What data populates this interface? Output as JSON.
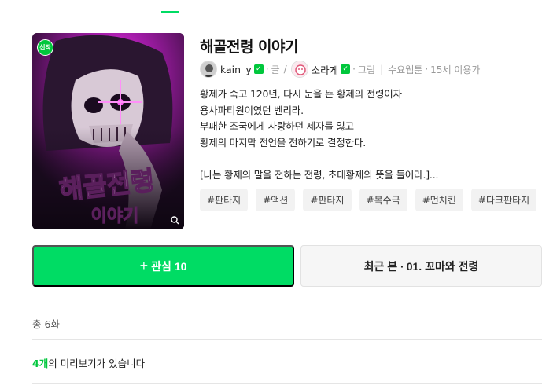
{
  "webtoon": {
    "title": "해골전령 이야기",
    "badge": "신작",
    "cover_title_line1": "해골전령",
    "cover_title_line2": "이야기",
    "authors": [
      {
        "name": "kain_y",
        "role": "글"
      },
      {
        "name": "소라게",
        "role": "그림"
      }
    ],
    "role_separator": "/",
    "day": "수요웹툰",
    "age": "15세 이용가",
    "synopsis": [
      "황제가 죽고 120년, 다시 눈을 뜬 황제의 전령이자",
      "용사파티원이였던 벤리라.",
      "부패한 조국에게 사랑하던 제자를 잃고",
      "황제의 마지막 전언을 전하기로 결정한다.",
      "",
      "[나는 황제의 말을 전하는 전령, 초대황제의 뜻을 들어라.]..."
    ],
    "tags": [
      "#판타지",
      "#액션",
      "#판타지",
      "#복수극",
      "#먼치킨",
      "#다크판타지"
    ]
  },
  "actions": {
    "favorite_plus": "+",
    "favorite_label": "관심",
    "favorite_count": "10",
    "recent_prefix": "최근 본 ·",
    "recent_episode": "01. 꼬마와 전령"
  },
  "episodes": {
    "total_label": "총 6화",
    "preview_count": "4개",
    "preview_text": "의 미리보기가 있습니다"
  },
  "colors": {
    "accent": "#00dc64",
    "badge": "#00c73c"
  },
  "icons": [
    "check-icon",
    "zoom-icon",
    "plus-icon"
  ]
}
